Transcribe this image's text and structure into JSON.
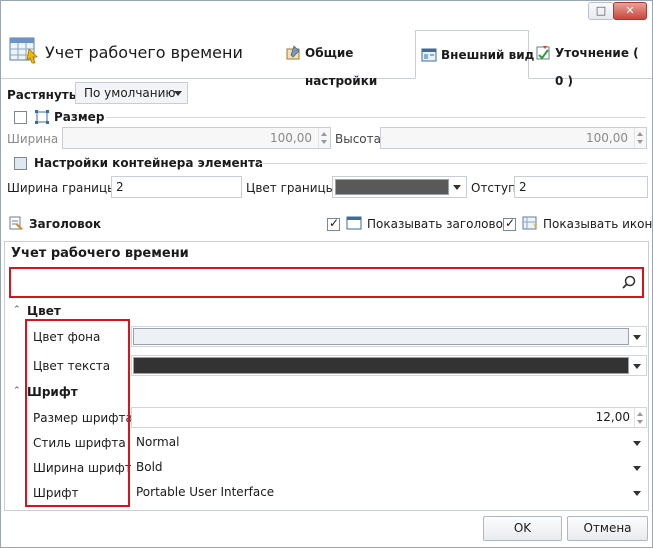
{
  "window": {
    "title": "Учет рабочего времени",
    "minimize_label": "□",
    "close_label": "✕"
  },
  "tabs": [
    {
      "label": "Общие настройки",
      "icon": "general-settings-icon"
    },
    {
      "label": "Внешний вид",
      "icon": "appearance-icon",
      "active": true
    },
    {
      "label": "Уточнение ( 0 )",
      "icon": "refine-icon"
    }
  ],
  "stretch": {
    "label": "Растянуть :",
    "value": "По умолчанию"
  },
  "size_group": {
    "label": "Размер",
    "width_label": "Ширина :",
    "width_value": "100,00",
    "height_label": "Высота :",
    "height_value": "100,00"
  },
  "container_group": {
    "label": "Настройки контейнера элемента",
    "border_width_label": "Ширина границы :",
    "border_width_value": "2",
    "border_color_label": "Цвет границы :",
    "border_color": "#595959",
    "indent_label": "Отступ :",
    "indent_value": "2"
  },
  "header_section": {
    "label": "Заголовок",
    "show_header_label": "Показывать заголовок",
    "show_icon_label": "Показывать иконку"
  },
  "panel": {
    "title": "Учет рабочего времени",
    "search_value": "",
    "categories": {
      "color": "Цвет",
      "font": "Шрифт"
    },
    "properties": {
      "bg_color_label": "Цвет фона",
      "bg_color": "#edf0f4",
      "text_color_label": "Цвет текста",
      "text_color": "#333333",
      "font_size_label": "Размер шрифта",
      "font_size_value": "12,00",
      "font_style_label": "Стиль шрифта",
      "font_style_value": "Normal",
      "font_weight_label": "Ширина шрифта",
      "font_weight_value": "Bold",
      "font_label": "Шрифт",
      "font_value": "Portable User Interface"
    }
  },
  "buttons": {
    "ok": "OK",
    "cancel": "Отмена"
  },
  "colors": {
    "highlight_red": "#d9121b",
    "border": "#c9ced6"
  }
}
